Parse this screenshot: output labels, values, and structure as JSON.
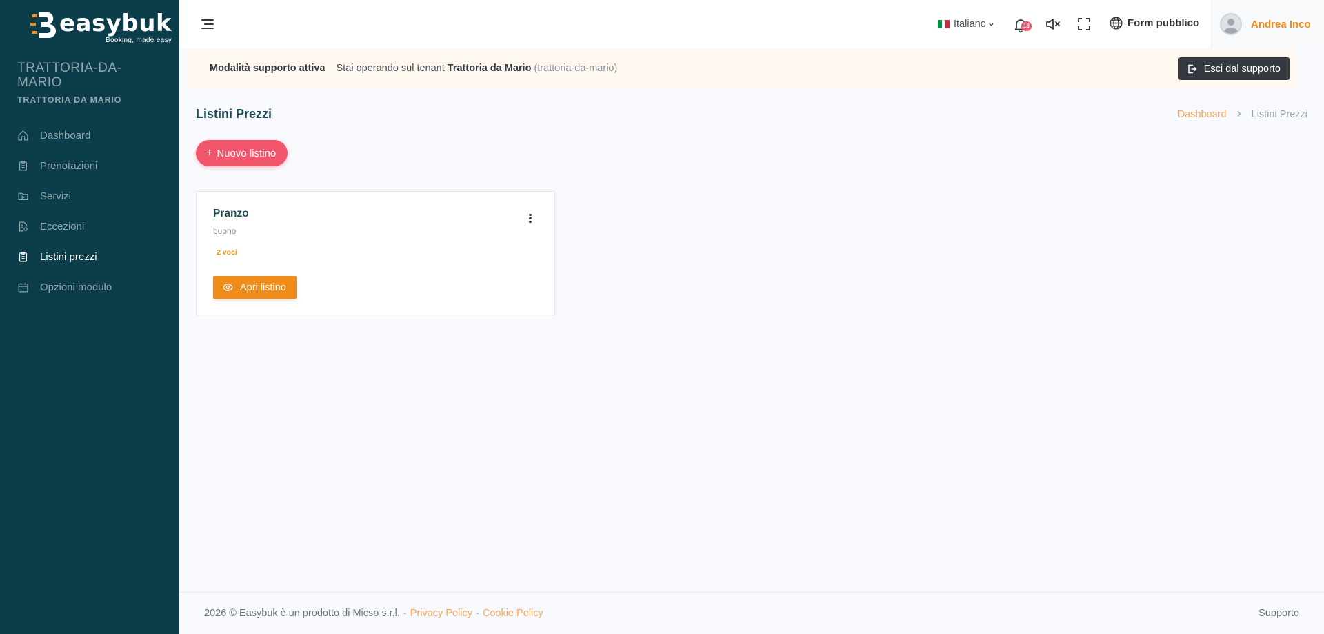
{
  "brand": {
    "name": "easybuk",
    "tagline": "Booking, made easy"
  },
  "sidebar": {
    "tenant_title": "TRATTORIA-DA-MARIO",
    "tenant_subtitle": "TRATTORIA DA MARIO",
    "items": [
      {
        "label": "Dashboard",
        "icon": "home-icon",
        "active": false
      },
      {
        "label": "Prenotazioni",
        "icon": "clipboard-icon",
        "active": false
      },
      {
        "label": "Servizi",
        "icon": "folder-icon",
        "active": false
      },
      {
        "label": "Eccezioni",
        "icon": "file-settings-icon",
        "active": false
      },
      {
        "label": "Listini prezzi",
        "icon": "clipboard-list-icon",
        "active": true
      },
      {
        "label": "Opzioni modulo",
        "icon": "calendar-icon",
        "active": false
      }
    ]
  },
  "topbar": {
    "language": "Italiano",
    "notifications_count": "18",
    "public_form_label": "Form pubblico",
    "user_name": "Andrea Inco"
  },
  "support_banner": {
    "title": "Modalità supporto attiva",
    "text_prefix": "Stai operando sul tenant",
    "tenant_name": "Trattoria da Mario",
    "tenant_slug": "(trattoria-da-mario)",
    "exit_label": "Esci dal supporto"
  },
  "page": {
    "title": "Listini Prezzi",
    "breadcrumb": {
      "home": "Dashboard",
      "current": "Listini Prezzi"
    },
    "new_button_label": "Nuovo listino"
  },
  "price_lists": [
    {
      "name": "Pranzo",
      "description": "buono",
      "items_count_label": "2 voci",
      "open_label": "Apri listino"
    }
  ],
  "footer": {
    "copyright": "2026 © Easybuk è un prodotto di Micso s.r.l.",
    "privacy_label": "Privacy Policy",
    "cookie_label": "Cookie Policy",
    "support_label": "Supporto"
  },
  "colors": {
    "sidebar_bg": "#0b3d4a",
    "accent_orange": "#f08c1a",
    "accent_pink": "#f1556c",
    "banner_bg": "#fff8f0"
  }
}
